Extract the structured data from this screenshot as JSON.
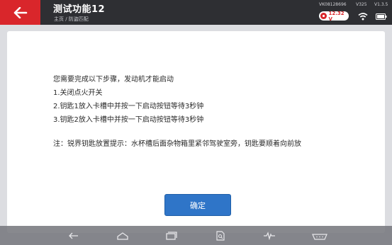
{
  "header": {
    "title": "测试功能12",
    "breadcrumb": "主页 / 防盗匹配",
    "vin": "VK08128696",
    "version_a": "V325",
    "version_b": "V1.3.5",
    "voltage": "12.32 V"
  },
  "dialog": {
    "lines": [
      "您需要完成以下步骤，发动机才能启动",
      "1.关闭点火开关",
      "2.钥匙1放入卡槽中并按一下启动按钮等待3秒钟",
      "3.钥匙2放入卡槽中并按一下启动按钮等待3秒钟",
      "注：锐界钥匙放置提示：水杯槽后面杂物箱里紧邻驾驶室旁，钥匙要顺着向前放"
    ],
    "ok_label": "确定"
  },
  "colors": {
    "accent_red": "#d9262b",
    "topbar": "#2e2f33",
    "button_blue": "#2f75c8"
  },
  "icons": [
    "back-arrow-icon",
    "wifi-icon",
    "battery-icon",
    "nav-back-icon",
    "nav-home-icon",
    "nav-recents-icon",
    "nav-report-icon",
    "nav-waveform-icon",
    "nav-obd-icon"
  ]
}
